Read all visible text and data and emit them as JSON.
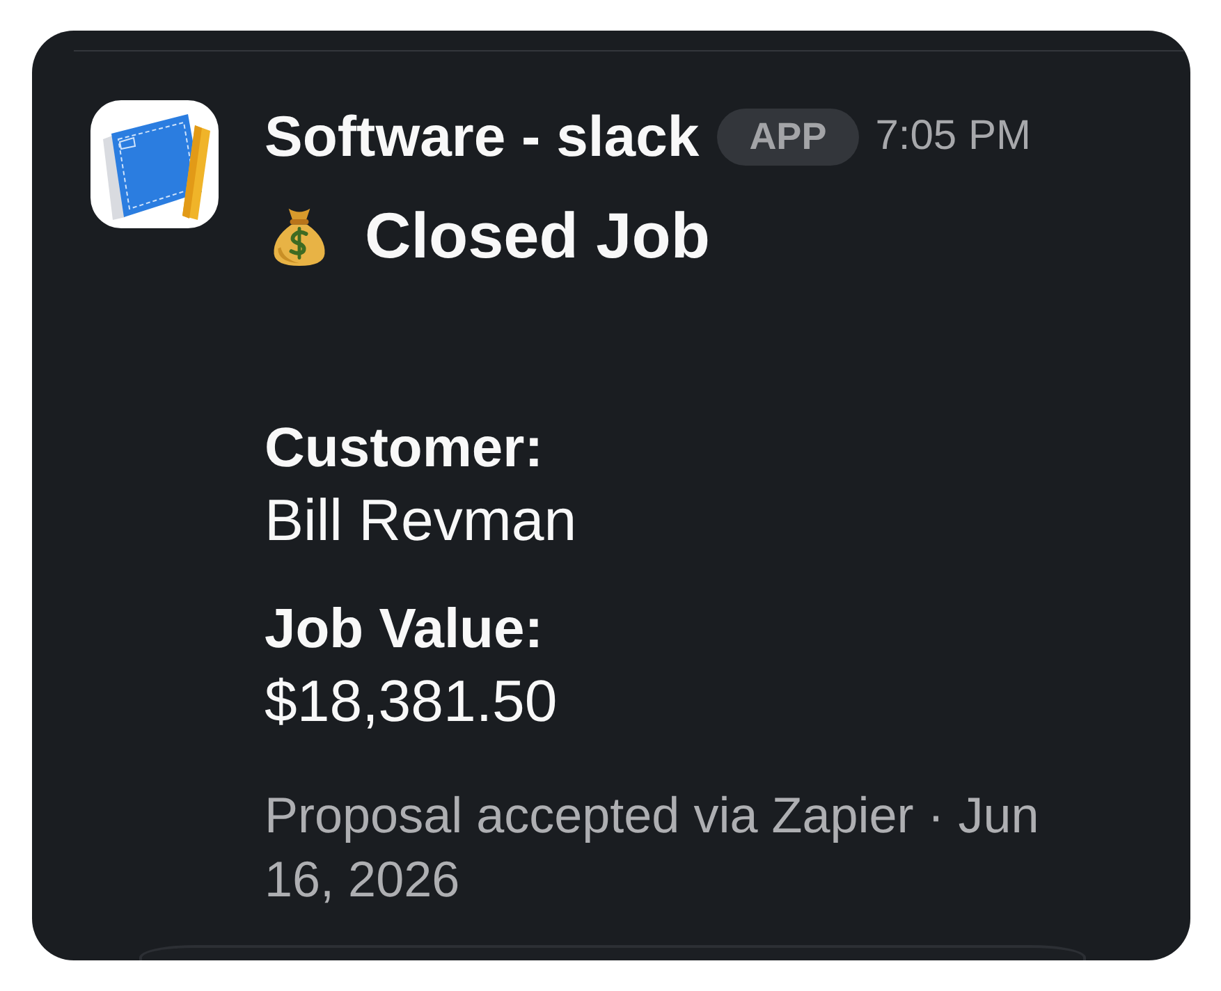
{
  "message": {
    "sender": "Software - slack",
    "badge": "APP",
    "time": "7:05 PM",
    "title": "Closed Job",
    "fields": [
      {
        "label": "Customer:",
        "value": "Bill Revman"
      },
      {
        "label": "Job Value:",
        "value": "$18,381.50"
      }
    ],
    "footer": "Proposal accepted via Zapier · Jun 16, 2026"
  }
}
